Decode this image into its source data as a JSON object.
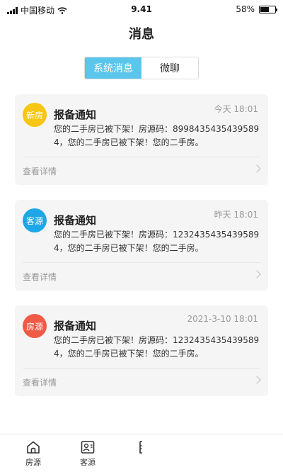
{
  "status_bar": {
    "carrier": "中国移动",
    "time": "9.41",
    "battery": "58%",
    "battery_level": 0.58
  },
  "page": {
    "title": "消息"
  },
  "tabs": [
    {
      "label": "系统消息",
      "active": true
    },
    {
      "label": "微聊",
      "active": false
    }
  ],
  "messages": [
    {
      "badge": "新房",
      "badge_color": "#f7c611",
      "title": "报备通知",
      "time": "今天 18:01",
      "body": "您的二手房已被下架！房源码：89984354354395894，您的二手房已被下架！您的二手房。",
      "detail": "查看详情"
    },
    {
      "badge": "客源",
      "badge_color": "#1ea7e8",
      "title": "报备通知",
      "time": "昨天 18:01",
      "body": "您的二手房已被下架！房源码：12324354354395894，您的二手房已被下架！您的二手房。",
      "detail": "查看详情"
    },
    {
      "badge": "房源",
      "badge_color": "#f05a46",
      "title": "报备通知",
      "time": "2021-3-10 18:01",
      "body": "您的二手房已被下架！房源码：12324354354395894，您的二手房已被下架！您的二手房。",
      "detail": "查看详情"
    }
  ],
  "tabbar": {
    "items": [
      {
        "label": "房源",
        "icon": "house-icon"
      },
      {
        "label": "客源",
        "icon": "contact-card-icon"
      },
      {
        "label": "",
        "icon": "partial-icon"
      }
    ]
  }
}
